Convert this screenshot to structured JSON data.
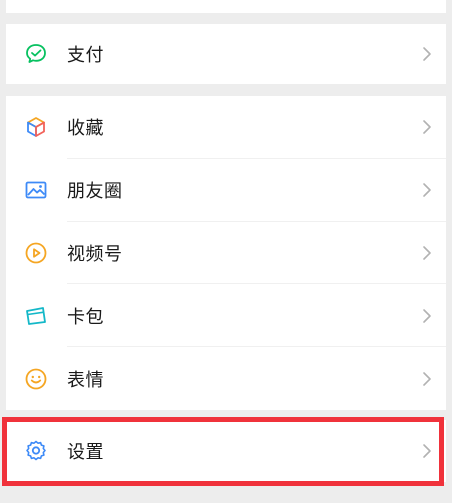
{
  "menu": {
    "pay": {
      "label": "支付",
      "icon": "wechat-pay-icon",
      "color": "#07c160"
    },
    "items": [
      {
        "label": "收藏",
        "icon": "favorites-cube-icon"
      },
      {
        "label": "朋友圈",
        "icon": "moments-picture-icon"
      },
      {
        "label": "视频号",
        "icon": "channels-play-icon"
      },
      {
        "label": "卡包",
        "icon": "card-wallet-icon"
      },
      {
        "label": "表情",
        "icon": "sticker-smile-icon"
      }
    ],
    "settings": {
      "label": "设置",
      "icon": "gear-icon",
      "color": "#3d8af7"
    }
  },
  "highlight": {
    "color": "#f0323b",
    "target": "设置"
  }
}
